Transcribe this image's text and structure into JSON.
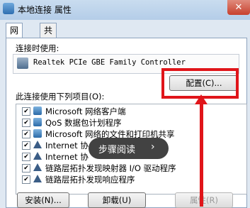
{
  "window": {
    "title": "本地连接 属性",
    "close_glyph": "✕"
  },
  "tabs": [
    {
      "label": "网络"
    },
    {
      "label": "共享"
    }
  ],
  "connect_using_label": "连接时使用:",
  "adapter_name": "Realtek PCIe GBE Family Controller",
  "configure_button": "配置(C)...",
  "items_label": "此连接使用下列项目(O):",
  "check_glyph": "✔",
  "items": [
    {
      "label": "Microsoft 网络客户端"
    },
    {
      "label": "QoS 数据包计划程序"
    },
    {
      "label": "Microsoft 网络的文件和打印机共享"
    },
    {
      "label": "Internet 协"
    },
    {
      "label": "Internet 协"
    },
    {
      "label": "链路层拓扑发现映射器 I/O 驱动程序"
    },
    {
      "label": "链路层拓扑发现响应程序"
    }
  ],
  "overlay": {
    "text": "步骤阅读",
    "arrow": "›"
  },
  "buttons": {
    "install": "安装(N)...",
    "uninstall": "卸载(U)",
    "properties": "属性(R)"
  },
  "colors": {
    "highlight_red": "#e0151a"
  }
}
